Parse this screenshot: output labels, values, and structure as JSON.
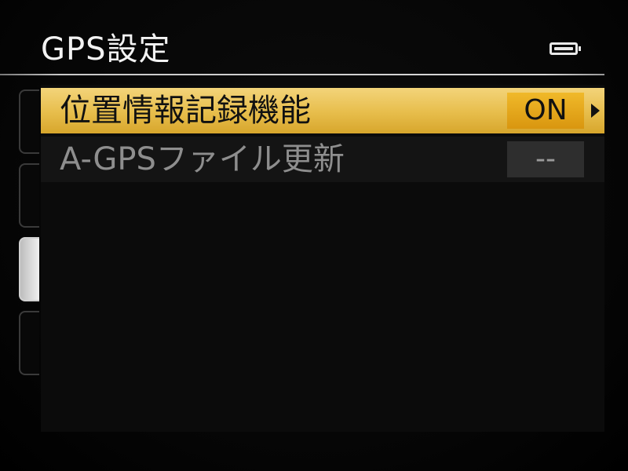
{
  "header": {
    "title": "GPS設定",
    "battery_icon": "battery-full-icon"
  },
  "side_tabs": {
    "count": 4,
    "active_index": 2
  },
  "menu": {
    "items": [
      {
        "label": "位置情報記録機能",
        "value": "ON",
        "selected": true,
        "enabled": true,
        "has_submenu_arrow": true
      },
      {
        "label": "A-GPSファイル更新",
        "value": "--",
        "selected": false,
        "enabled": false,
        "has_submenu_arrow": false
      }
    ]
  },
  "colors": {
    "selected_row": "#e7bd4b",
    "selected_value": "#e3a51a",
    "disabled_text": "#8e8e8e",
    "background": "#000000"
  }
}
